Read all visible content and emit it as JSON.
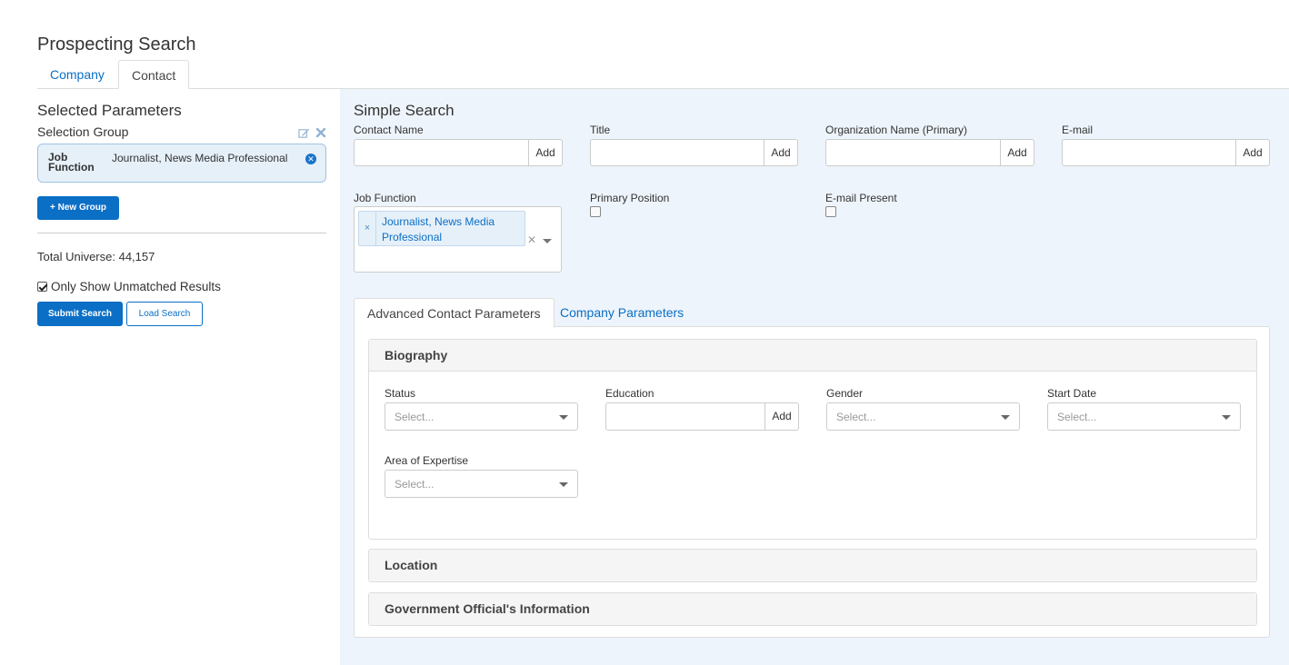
{
  "page": {
    "title": "Prospecting Search"
  },
  "tabs": {
    "company": "Company",
    "contact": "Contact"
  },
  "left": {
    "selected_params_title": "Selected Parameters",
    "selection_group_label": "Selection Group",
    "group": {
      "key": "Job Function",
      "value": "Journalist, News Media Professional"
    },
    "new_group_label": "+ New Group",
    "total_universe": "Total Universe: 44,157",
    "only_unmatched_label": "Only Show Unmatched Results",
    "only_unmatched_checked": true,
    "submit_label": "Submit Search",
    "load_label": "Load Search"
  },
  "simple": {
    "title": "Simple Search",
    "add_label": "Add",
    "contact_name_label": "Contact Name",
    "title_label": "Title",
    "org_label": "Organization Name (Primary)",
    "email_label": "E-mail",
    "job_function_label": "Job Function",
    "job_function_chip": "Journalist, News Media Professional",
    "primary_position_label": "Primary Position",
    "email_present_label": "E-mail Present"
  },
  "advanced": {
    "tab_contact": "Advanced Contact Parameters",
    "tab_company": "Company Parameters",
    "biography": {
      "heading": "Biography",
      "status_label": "Status",
      "education_label": "Education",
      "gender_label": "Gender",
      "start_date_label": "Start Date",
      "area_label": "Area of Expertise",
      "select_placeholder": "Select..."
    },
    "location_heading": "Location",
    "gov_heading": "Government Official's Information"
  },
  "colors": {
    "accent": "#0b6fc6",
    "panel_bg": "#eef4fb",
    "chip_bg": "#e6f0f9"
  }
}
